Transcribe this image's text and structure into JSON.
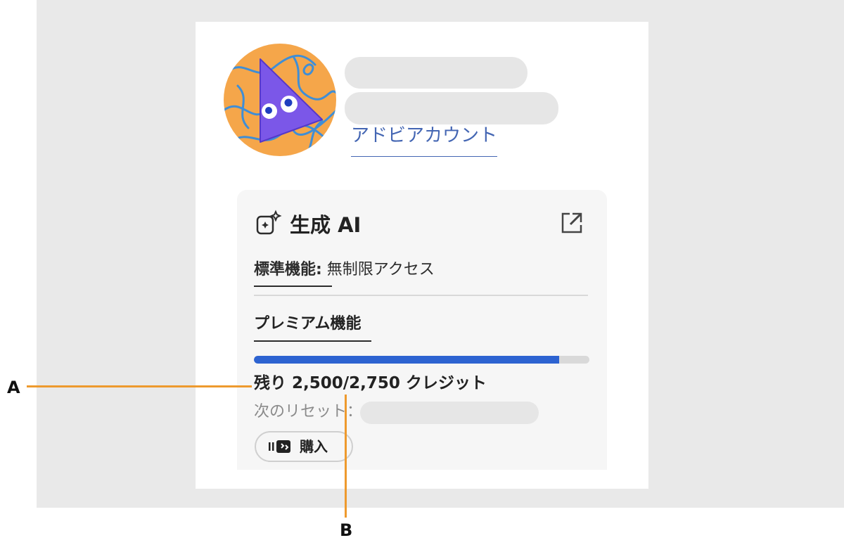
{
  "account": {
    "link_label": "アドビアカウント"
  },
  "ai_card": {
    "title": "生成 AI",
    "icon": "generative-ai-sparkle-icon",
    "external_icon": "open-external-icon",
    "standard": {
      "label": "標準機能:",
      "value": " 無制限アクセス"
    },
    "premium": {
      "label": "プレミアム機能",
      "progress_fraction": 0.909,
      "credits_text": "残り 2,500/2,750 クレジット",
      "reset_label": "次のリセット：",
      "buy_label": "購入",
      "buy_icon": "credits-icon"
    }
  },
  "callouts": {
    "a": "A",
    "b": "B"
  },
  "colors": {
    "accent_blue": "#2d63d1",
    "link_blue": "#4466b3",
    "callout_orange": "#ee9a2e",
    "avatar_orange": "#f5a64a",
    "avatar_purple": "#7b57e8"
  }
}
